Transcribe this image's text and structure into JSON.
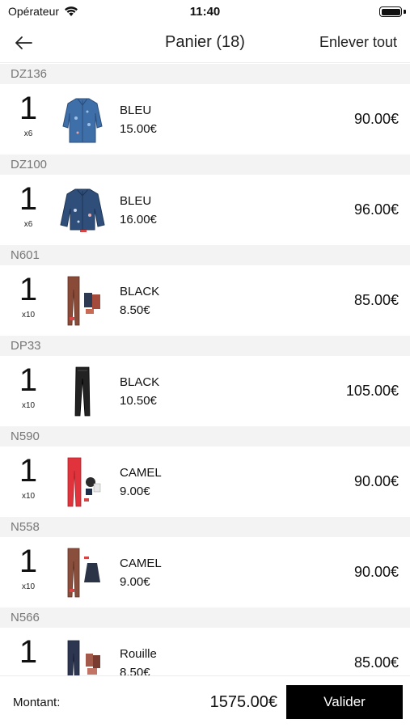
{
  "status_bar": {
    "carrier": "Opérateur",
    "time": "11:40"
  },
  "nav": {
    "title": "Panier (18)",
    "clear_label": "Enlever tout"
  },
  "sections": [
    {
      "code": "DZ136",
      "qty": "1",
      "multiplier": "x6",
      "color": "BLEU",
      "unit_price": "15.00€",
      "total": "90.00€",
      "thumb": "denim-jacket-long"
    },
    {
      "code": "DZ100",
      "qty": "1",
      "multiplier": "x6",
      "color": "BLEU",
      "unit_price": "16.00€",
      "total": "96.00€",
      "thumb": "denim-jacket-short"
    },
    {
      "code": "N601",
      "qty": "1",
      "multiplier": "x10",
      "color": "BLACK",
      "unit_price": "8.50€",
      "total": "85.00€",
      "thumb": "brown-pants-swatches"
    },
    {
      "code": "DP33",
      "qty": "1",
      "multiplier": "x10",
      "color": "BLACK",
      "unit_price": "10.50€",
      "total": "105.00€",
      "thumb": "black-pants"
    },
    {
      "code": "N590",
      "qty": "1",
      "multiplier": "x10",
      "color": "CAMEL",
      "unit_price": "9.00€",
      "total": "90.00€",
      "thumb": "red-pants-swatches"
    },
    {
      "code": "N558",
      "qty": "1",
      "multiplier": "x10",
      "color": "CAMEL",
      "unit_price": "9.00€",
      "total": "90.00€",
      "thumb": "brown-pants-skirt"
    },
    {
      "code": "N566",
      "qty": "1",
      "multiplier": "",
      "color": "Rouille",
      "unit_price": "8.50€",
      "total": "85.00€",
      "thumb": "navy-pants-swatches"
    }
  ],
  "footer": {
    "amount_label": "Montant:",
    "amount_total": "1575.00€",
    "validate_label": "Valider"
  },
  "colors": {
    "section_bg": "#f3f3f3",
    "section_text": "#777777",
    "button_bg": "#000000",
    "button_text": "#ffffff"
  }
}
